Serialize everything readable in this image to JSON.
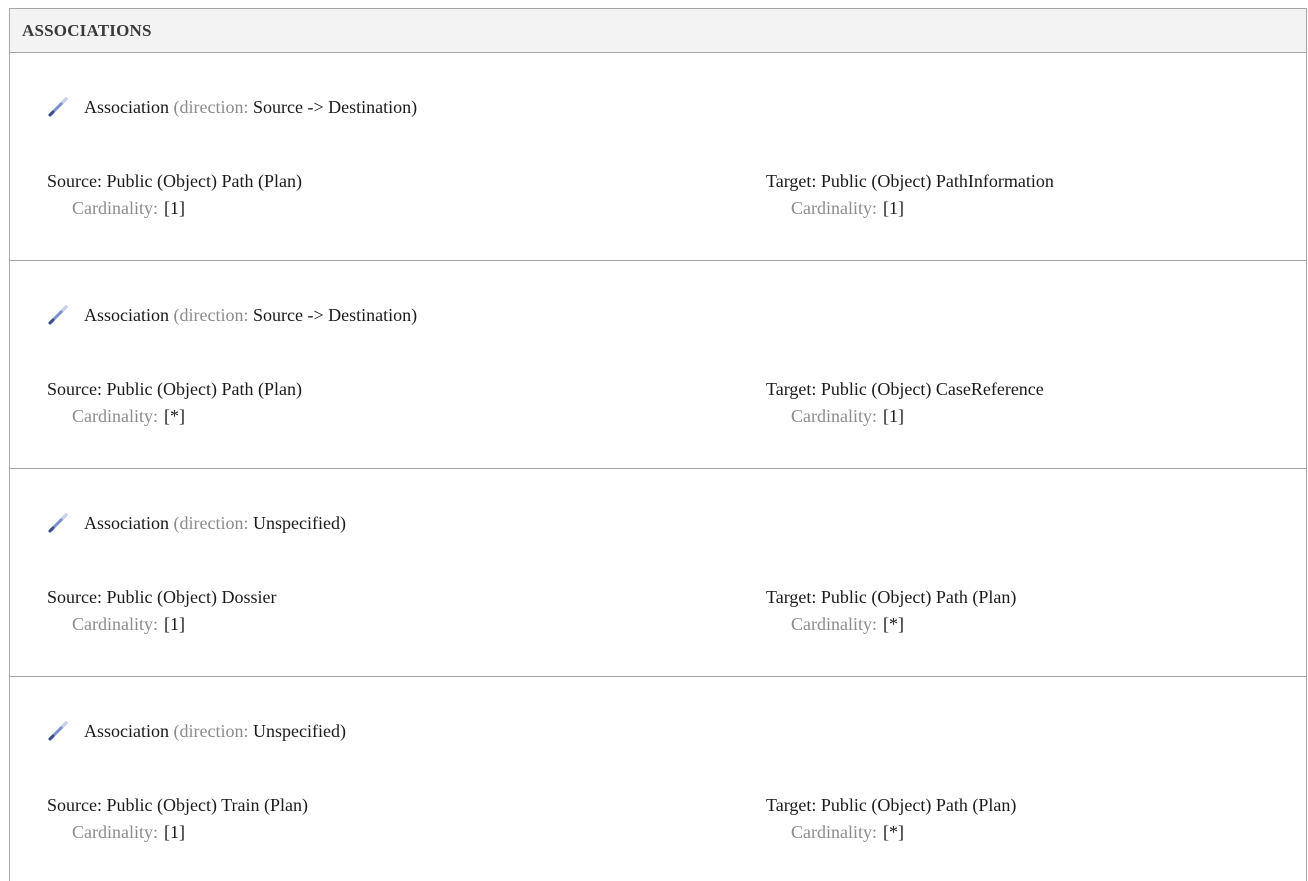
{
  "section": {
    "title": "ASSOCIATIONS"
  },
  "labels": {
    "association": "Association",
    "direction": "direction:",
    "cardinality": "Cardinality:",
    "source_prefix": "Source:",
    "target_prefix": "Target:"
  },
  "icons": {
    "edit": "pencil-icon"
  },
  "associations": [
    {
      "direction": "Source -> Destination",
      "source": "Public (Object) Path (Plan)",
      "source_cardinality": "[1]",
      "target": "Public (Object) PathInformation",
      "target_cardinality": "[1]"
    },
    {
      "direction": "Source -> Destination",
      "source": "Public (Object) Path (Plan)",
      "source_cardinality": "[*]",
      "target": "Public (Object) CaseReference",
      "target_cardinality": "[1]"
    },
    {
      "direction": "Unspecified",
      "source": "Public (Object) Dossier",
      "source_cardinality": "[1]",
      "target": "Public (Object) Path (Plan)",
      "target_cardinality": "[*]"
    },
    {
      "direction": "Unspecified",
      "source": "Public (Object) Train (Plan)",
      "source_cardinality": "[1]",
      "target": "Public (Object) Path (Plan)",
      "target_cardinality": "[*]"
    }
  ]
}
